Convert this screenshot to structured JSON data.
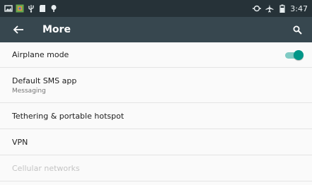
{
  "status_bar": {
    "left_icons": [
      "image-icon",
      "app-icon",
      "usb-icon",
      "sd-card-icon",
      "notification-icon"
    ],
    "right_icons": [
      "sync-icon",
      "airplane-icon",
      "battery-icon"
    ],
    "time": "3:47"
  },
  "toolbar": {
    "title": "More",
    "back_icon": "arrow-back-icon",
    "search_icon": "search-icon"
  },
  "settings": [
    {
      "title": "Airplane mode",
      "toggle_on": true
    },
    {
      "title": "Default SMS app",
      "subtitle": "Messaging"
    },
    {
      "title": "Tethering & portable hotspot"
    },
    {
      "title": "VPN"
    },
    {
      "title": "Cellular networks",
      "disabled": true
    }
  ],
  "colors": {
    "status_bar": "#263238",
    "toolbar": "#37474f",
    "accent": "#009688"
  }
}
